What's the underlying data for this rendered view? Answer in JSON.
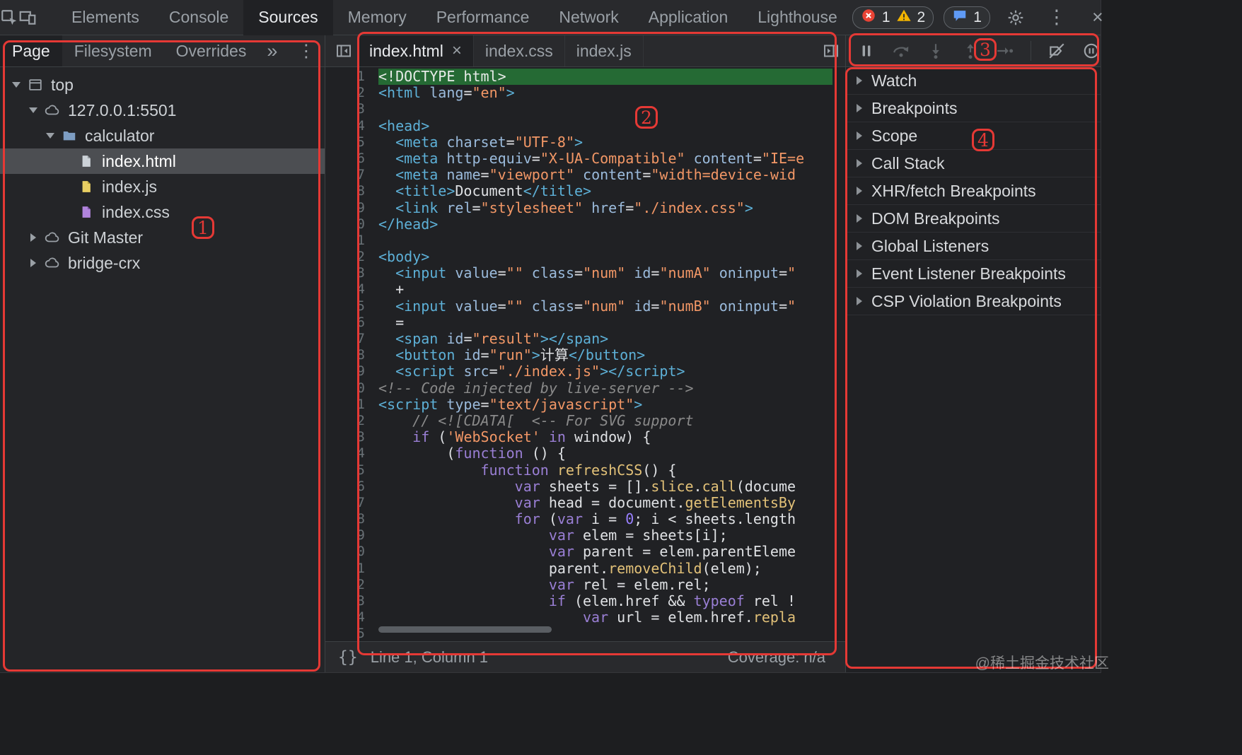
{
  "glyphs": {
    "kebab": "⋮",
    "close": "×",
    "overflow": "»"
  },
  "top_bar": {
    "tabs": [
      "Elements",
      "Console",
      "Sources",
      "Memory",
      "Performance",
      "Network",
      "Application",
      "Lighthouse"
    ],
    "active_tab": "Sources",
    "error_count": "1",
    "warning_count": "2",
    "issues_count": "1"
  },
  "navigator": {
    "tabs": [
      "Page",
      "Filesystem",
      "Overrides"
    ],
    "active_tab": "Page",
    "tree": [
      {
        "label": "top",
        "depth": 0,
        "expanded": true,
        "icon": "frame"
      },
      {
        "label": "127.0.0.1:5501",
        "depth": 1,
        "expanded": true,
        "icon": "cloud"
      },
      {
        "label": "calculator",
        "depth": 2,
        "expanded": true,
        "icon": "folder"
      },
      {
        "label": "index.html",
        "depth": 3,
        "icon": "file-html",
        "selected": true
      },
      {
        "label": "index.js",
        "depth": 3,
        "icon": "file-js"
      },
      {
        "label": "index.css",
        "depth": 3,
        "icon": "file-css"
      },
      {
        "label": "Git Master",
        "depth": 1,
        "expanded": false,
        "icon": "cloud"
      },
      {
        "label": "bridge-crx",
        "depth": 1,
        "expanded": false,
        "icon": "cloud"
      }
    ]
  },
  "editor": {
    "tabs": [
      {
        "label": "index.html",
        "active": true
      },
      {
        "label": "index.css"
      },
      {
        "label": "index.js"
      }
    ],
    "pretty_print_glyph": "{}",
    "status_line": "Line 1, Column 1",
    "coverage": "Coverage: n/a",
    "code_lines": [
      {
        "h": 1,
        "s": [
          [
            "d",
            "<!DOCTYPE html>"
          ]
        ]
      },
      {
        "s": [
          [
            "t",
            "<html"
          ],
          [
            "p",
            " "
          ],
          [
            "a",
            "lang"
          ],
          [
            "p",
            "="
          ],
          [
            "s",
            "\"en\""
          ],
          [
            "t",
            ">"
          ]
        ]
      },
      {
        "s": []
      },
      {
        "s": [
          [
            "t",
            "<head>"
          ]
        ]
      },
      {
        "s": [
          [
            "p",
            "  "
          ],
          [
            "t",
            "<meta"
          ],
          [
            "p",
            " "
          ],
          [
            "a",
            "charset"
          ],
          [
            "p",
            "="
          ],
          [
            "s",
            "\"UTF-8\""
          ],
          [
            "t",
            ">"
          ]
        ]
      },
      {
        "s": [
          [
            "p",
            "  "
          ],
          [
            "t",
            "<meta"
          ],
          [
            "p",
            " "
          ],
          [
            "a",
            "http-equiv"
          ],
          [
            "p",
            "="
          ],
          [
            "s",
            "\"X-UA-Compatible\""
          ],
          [
            "p",
            " "
          ],
          [
            "a",
            "content"
          ],
          [
            "p",
            "="
          ],
          [
            "s",
            "\"IE=e"
          ]
        ]
      },
      {
        "s": [
          [
            "p",
            "  "
          ],
          [
            "t",
            "<meta"
          ],
          [
            "p",
            " "
          ],
          [
            "a",
            "name"
          ],
          [
            "p",
            "="
          ],
          [
            "s",
            "\"viewport\""
          ],
          [
            "p",
            " "
          ],
          [
            "a",
            "content"
          ],
          [
            "p",
            "="
          ],
          [
            "s",
            "\"width=device-wid"
          ]
        ]
      },
      {
        "s": [
          [
            "p",
            "  "
          ],
          [
            "t",
            "<title>"
          ],
          [
            "p",
            "Document"
          ],
          [
            "t",
            "</title>"
          ]
        ]
      },
      {
        "s": [
          [
            "p",
            "  "
          ],
          [
            "t",
            "<link"
          ],
          [
            "p",
            " "
          ],
          [
            "a",
            "rel"
          ],
          [
            "p",
            "="
          ],
          [
            "s",
            "\"stylesheet\""
          ],
          [
            "p",
            " "
          ],
          [
            "a",
            "href"
          ],
          [
            "p",
            "="
          ],
          [
            "s",
            "\"./index.css\""
          ],
          [
            "t",
            ">"
          ]
        ]
      },
      {
        "s": [
          [
            "t",
            "</head>"
          ]
        ]
      },
      {
        "s": []
      },
      {
        "s": [
          [
            "t",
            "<body>"
          ]
        ]
      },
      {
        "s": [
          [
            "p",
            "  "
          ],
          [
            "t",
            "<input"
          ],
          [
            "p",
            " "
          ],
          [
            "a",
            "value"
          ],
          [
            "p",
            "="
          ],
          [
            "s",
            "\"\""
          ],
          [
            "p",
            " "
          ],
          [
            "a",
            "class"
          ],
          [
            "p",
            "="
          ],
          [
            "s",
            "\"num\""
          ],
          [
            "p",
            " "
          ],
          [
            "a",
            "id"
          ],
          [
            "p",
            "="
          ],
          [
            "s",
            "\"numA\""
          ],
          [
            "p",
            " "
          ],
          [
            "a",
            "oninput"
          ],
          [
            "p",
            "="
          ],
          [
            "s",
            "\""
          ]
        ]
      },
      {
        "s": [
          [
            "p",
            "  +"
          ]
        ]
      },
      {
        "s": [
          [
            "p",
            "  "
          ],
          [
            "t",
            "<input"
          ],
          [
            "p",
            " "
          ],
          [
            "a",
            "value"
          ],
          [
            "p",
            "="
          ],
          [
            "s",
            "\"\""
          ],
          [
            "p",
            " "
          ],
          [
            "a",
            "class"
          ],
          [
            "p",
            "="
          ],
          [
            "s",
            "\"num\""
          ],
          [
            "p",
            " "
          ],
          [
            "a",
            "id"
          ],
          [
            "p",
            "="
          ],
          [
            "s",
            "\"numB\""
          ],
          [
            "p",
            " "
          ],
          [
            "a",
            "oninput"
          ],
          [
            "p",
            "="
          ],
          [
            "s",
            "\""
          ]
        ]
      },
      {
        "s": [
          [
            "p",
            "  ="
          ]
        ]
      },
      {
        "s": [
          [
            "p",
            "  "
          ],
          [
            "t",
            "<span"
          ],
          [
            "p",
            " "
          ],
          [
            "a",
            "id"
          ],
          [
            "p",
            "="
          ],
          [
            "s",
            "\"result\""
          ],
          [
            "t",
            "></span>"
          ]
        ]
      },
      {
        "s": [
          [
            "p",
            "  "
          ],
          [
            "t",
            "<button"
          ],
          [
            "p",
            " "
          ],
          [
            "a",
            "id"
          ],
          [
            "p",
            "="
          ],
          [
            "s",
            "\"run\""
          ],
          [
            "t",
            ">"
          ],
          [
            "p",
            "计算"
          ],
          [
            "t",
            "</button>"
          ]
        ]
      },
      {
        "s": [
          [
            "p",
            "  "
          ],
          [
            "t",
            "<script"
          ],
          [
            "p",
            " "
          ],
          [
            "a",
            "src"
          ],
          [
            "p",
            "="
          ],
          [
            "s",
            "\"./index.js\""
          ],
          [
            "t",
            "></script>"
          ]
        ]
      },
      {
        "s": [
          [
            "c",
            "<!-- Code injected by live-server -->"
          ]
        ]
      },
      {
        "s": [
          [
            "t",
            "<script"
          ],
          [
            "p",
            " "
          ],
          [
            "a",
            "type"
          ],
          [
            "p",
            "="
          ],
          [
            "s",
            "\"text/javascript\""
          ],
          [
            "t",
            ">"
          ]
        ]
      },
      {
        "s": [
          [
            "p",
            "    "
          ],
          [
            "c",
            "// <![CDATA[  <-- For SVG support"
          ]
        ]
      },
      {
        "s": [
          [
            "p",
            "    "
          ],
          [
            "k",
            "if"
          ],
          [
            "p",
            " ("
          ],
          [
            "s",
            "'WebSocket'"
          ],
          [
            "p",
            " "
          ],
          [
            "k",
            "in"
          ],
          [
            "p",
            " window) {"
          ]
        ]
      },
      {
        "s": [
          [
            "p",
            "        ("
          ],
          [
            "k",
            "function"
          ],
          [
            "p",
            " () {"
          ]
        ]
      },
      {
        "s": [
          [
            "p",
            "            "
          ],
          [
            "k",
            "function"
          ],
          [
            "p",
            " "
          ],
          [
            "f",
            "refreshCSS"
          ],
          [
            "p",
            "() {"
          ]
        ]
      },
      {
        "s": [
          [
            "p",
            "                "
          ],
          [
            "k",
            "var"
          ],
          [
            "p",
            " sheets = []."
          ],
          [
            "f",
            "slice"
          ],
          [
            "p",
            "."
          ],
          [
            "f",
            "call"
          ],
          [
            "p",
            "(docume"
          ]
        ]
      },
      {
        "s": [
          [
            "p",
            "                "
          ],
          [
            "k",
            "var"
          ],
          [
            "p",
            " head = document."
          ],
          [
            "f",
            "getElementsBy"
          ]
        ]
      },
      {
        "s": [
          [
            "p",
            "                "
          ],
          [
            "k",
            "for"
          ],
          [
            "p",
            " ("
          ],
          [
            "k",
            "var"
          ],
          [
            "p",
            " i = "
          ],
          [
            "n",
            "0"
          ],
          [
            "p",
            "; i < sheets.length"
          ]
        ]
      },
      {
        "s": [
          [
            "p",
            "                    "
          ],
          [
            "k",
            "var"
          ],
          [
            "p",
            " elem = sheets[i];"
          ]
        ]
      },
      {
        "s": [
          [
            "p",
            "                    "
          ],
          [
            "k",
            "var"
          ],
          [
            "p",
            " parent = elem.parentEleme"
          ]
        ]
      },
      {
        "s": [
          [
            "p",
            "                    parent."
          ],
          [
            "f",
            "removeChild"
          ],
          [
            "p",
            "(elem);"
          ]
        ]
      },
      {
        "s": [
          [
            "p",
            "                    "
          ],
          [
            "k",
            "var"
          ],
          [
            "p",
            " rel = elem.rel;"
          ]
        ]
      },
      {
        "s": [
          [
            "p",
            "                    "
          ],
          [
            "k",
            "if"
          ],
          [
            "p",
            " (elem.href && "
          ],
          [
            "k",
            "typeof"
          ],
          [
            "p",
            " rel !"
          ]
        ]
      },
      {
        "s": [
          [
            "p",
            "                        "
          ],
          [
            "k",
            "var"
          ],
          [
            "p",
            " url = elem.href."
          ],
          [
            "f",
            "repla"
          ]
        ]
      },
      {
        "s": []
      }
    ]
  },
  "debugger": {
    "toolbar": [
      {
        "name": "pause"
      },
      {
        "name": "step-over",
        "disabled": true
      },
      {
        "name": "step-into",
        "disabled": true
      },
      {
        "name": "step-out",
        "disabled": true
      },
      {
        "name": "step",
        "disabled": true
      },
      {
        "name": "separator"
      },
      {
        "name": "deactivate-breakpoints"
      },
      {
        "name": "pause-on-exceptions"
      }
    ],
    "sections": [
      "Watch",
      "Breakpoints",
      "Scope",
      "Call Stack",
      "XHR/fetch Breakpoints",
      "DOM Breakpoints",
      "Global Listeners",
      "Event Listener Breakpoints",
      "CSP Violation Breakpoints"
    ]
  },
  "annotations": {
    "one": "1",
    "two": "2",
    "three": "3",
    "four": "4"
  },
  "watermark": "@稀土掘金技术社区"
}
